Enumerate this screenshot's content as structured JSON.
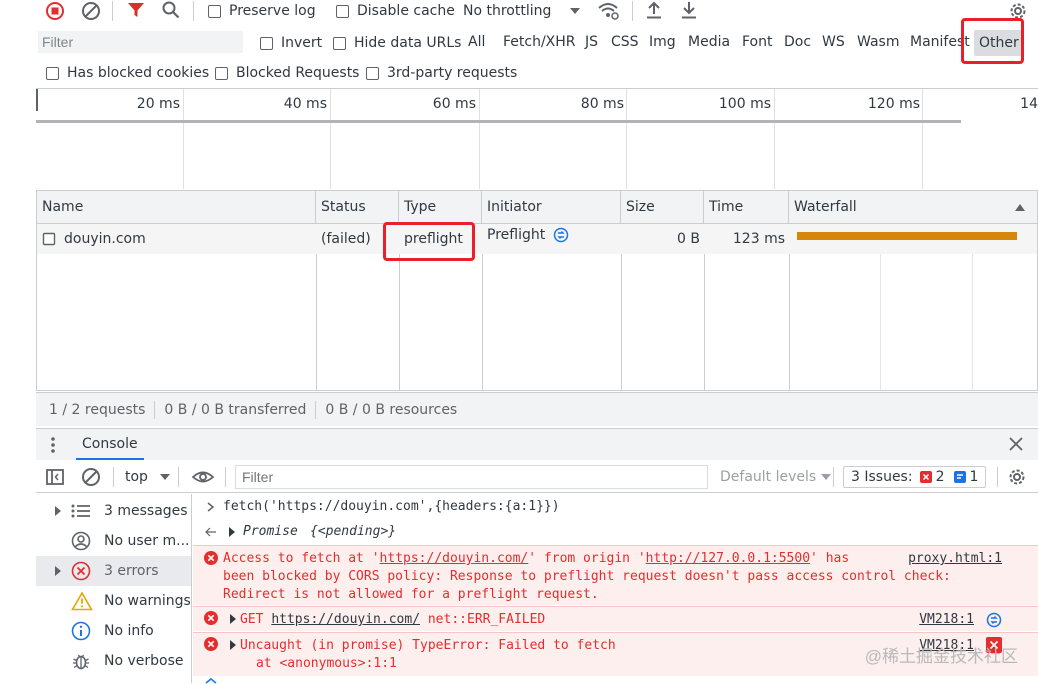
{
  "toolbar": {
    "preserve_log": "Preserve log",
    "disable_cache": "Disable cache",
    "throttling": "No throttling"
  },
  "filterbar": {
    "placeholder": "Filter",
    "invert": "Invert",
    "hide_data_urls": "Hide data URLs",
    "types": [
      "All",
      "Fetch/XHR",
      "JS",
      "CSS",
      "Img",
      "Media",
      "Font",
      "Doc",
      "WS",
      "Wasm",
      "Manifest",
      "Other"
    ]
  },
  "filterbar2": {
    "blocked_cookies": "Has blocked cookies",
    "blocked_requests": "Blocked Requests",
    "third_party": "3rd-party requests"
  },
  "overview": {
    "ticks": [
      "20 ms",
      "40 ms",
      "60 ms",
      "80 ms",
      "100 ms",
      "120 ms",
      "14"
    ]
  },
  "table": {
    "headers": [
      "Name",
      "Status",
      "Type",
      "Initiator",
      "Size",
      "Time",
      "Waterfall"
    ],
    "rows": [
      {
        "name": "douyin.com",
        "status": "(failed)",
        "type": "preflight",
        "initiator": "Preflight",
        "size": "0 B",
        "time": "123 ms"
      }
    ]
  },
  "summary": {
    "requests": "1 / 2 requests",
    "transferred": "0 B / 0 B transferred",
    "resources": "0 B / 0 B resources"
  },
  "console": {
    "tab": "Console",
    "context": "top",
    "filter_placeholder": "Filter",
    "levels": "Default levels",
    "issues_label": "3 Issues:",
    "issues_errors": "2",
    "issues_info": "1",
    "sidebar": [
      {
        "label": "3 messages",
        "icon": "list-icon"
      },
      {
        "label": "No user m...",
        "icon": "user-icon"
      },
      {
        "label": "3 errors",
        "icon": "error-icon"
      },
      {
        "label": "No warnings",
        "icon": "warning-icon"
      },
      {
        "label": "No info",
        "icon": "info-icon"
      },
      {
        "label": "No verbose",
        "icon": "bug-icon"
      }
    ],
    "messages": {
      "input": "fetch('https://douyin.com',{headers:{a:1}})",
      "promise_prefix": "Promise",
      "promise_value": "{<pending>}",
      "err1_a": "Access to fetch at '",
      "err1_url1": "https://douyin.com/",
      "err1_b": "' from origin '",
      "err1_url2": "http://127.0.0.1:5500",
      "err1_c": "' has",
      "err1_line2": "been blocked by CORS policy: Response to preflight request doesn't pass access control check:",
      "err1_line3": "Redirect is not allowed for a preflight request.",
      "err1_src": "proxy.html:1",
      "err2_get": "GET",
      "err2_url": "https://douyin.com/",
      "err2_rest": "net::ERR_FAILED",
      "err2_src": "VM218:1",
      "err3_line1": "Uncaught (in promise) TypeError: Failed to fetch",
      "err3_line2": "at <anonymous>:1:1",
      "err3_src": "VM218:1"
    }
  },
  "watermark": "@稀土掘金技术社区",
  "colors": {
    "accent_red": "#e8202a",
    "error_text": "#e42e2e",
    "waterfall_bar": "#d4870b",
    "info_blue": "#1a73e8"
  }
}
